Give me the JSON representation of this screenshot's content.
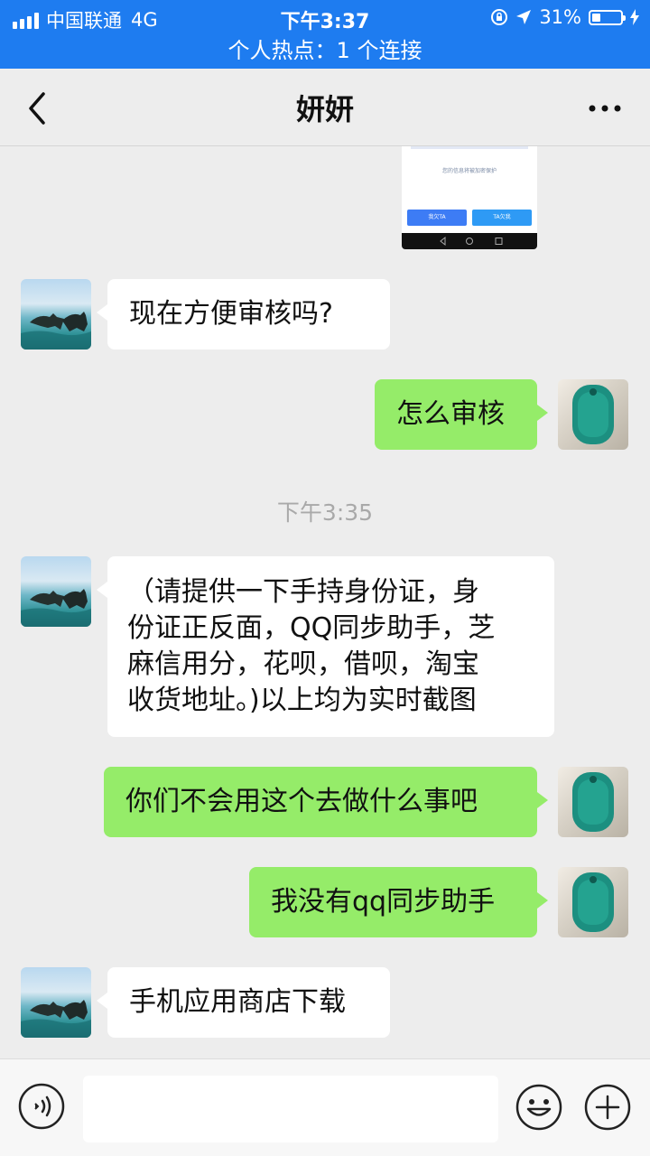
{
  "status_bar": {
    "carrier": "中国联通",
    "network": "4G",
    "time": "下午3:37",
    "battery_percent": "31%",
    "battery_level": 0.31
  },
  "hotspot": {
    "text": "个人热点：1 个连接"
  },
  "nav": {
    "title": "妍妍"
  },
  "thumbnail": {
    "note": "您的信息将被加密保护",
    "left_button": "我欠TA",
    "right_button": "TA欠我"
  },
  "messages": [
    {
      "side": "left",
      "text": "现在方便审核吗?"
    },
    {
      "side": "right",
      "text": "怎么审核"
    },
    {
      "side": "left",
      "lines": [
        "（请提供一下手持身份证，身",
        "份证正反面，QQ同步助手，芝",
        "麻信用分，花呗，借呗，淘宝",
        "收货地址。)以上均为实时截图"
      ]
    },
    {
      "side": "right",
      "text": "你们不会用这个去做什么事吧"
    },
    {
      "side": "right",
      "text": "我没有qq同步助手"
    },
    {
      "side": "left",
      "text": "手机应用商店下载"
    }
  ],
  "timestamp": "下午3:35",
  "colors": {
    "accent": "#1e7cf0",
    "my_bubble": "#95ec69",
    "their_bubble": "#ffffff",
    "background": "#ededed"
  },
  "icons": [
    "signal-icon",
    "lock-rotation-icon",
    "location-arrow-icon",
    "battery-icon",
    "charging-icon",
    "back-chevron-icon",
    "more-icon",
    "voice-icon",
    "emoji-icon",
    "plus-icon"
  ]
}
